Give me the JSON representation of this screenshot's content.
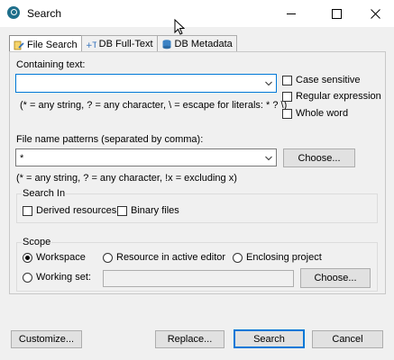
{
  "window": {
    "title": "Search",
    "icon": "eclipse-search-icon"
  },
  "tabs": [
    {
      "label": "File Search",
      "icon": "file-search-icon"
    },
    {
      "label": "DB Full-Text",
      "icon": "db-fulltext-icon"
    },
    {
      "label": "DB Metadata",
      "icon": "db-metadata-icon"
    }
  ],
  "containing": {
    "label": "Containing text:",
    "value": "",
    "hint": "(* = any string, ? = any character, \\ = escape for literals: * ? \\)",
    "case_sensitive": "Case sensitive",
    "regular_expression": "Regular expression",
    "whole_word": "Whole word"
  },
  "patterns": {
    "label": "File name patterns (separated by comma):",
    "value": "*",
    "choose": "Choose...",
    "hint": "(* = any string, ? = any character, !x = excluding x)"
  },
  "search_in": {
    "title": "Search In",
    "derived": "Derived resources",
    "binary": "Binary files"
  },
  "scope": {
    "title": "Scope",
    "workspace": "Workspace",
    "active_editor": "Resource in active editor",
    "enclosing": "Enclosing project",
    "working_set": "Working set:",
    "working_set_value": "",
    "choose": "Choose..."
  },
  "buttons": {
    "customize": "Customize...",
    "replace": "Replace...",
    "search": "Search",
    "cancel": "Cancel"
  },
  "colors": {
    "accent": "#0078d7",
    "background": "#f0f0f0"
  }
}
